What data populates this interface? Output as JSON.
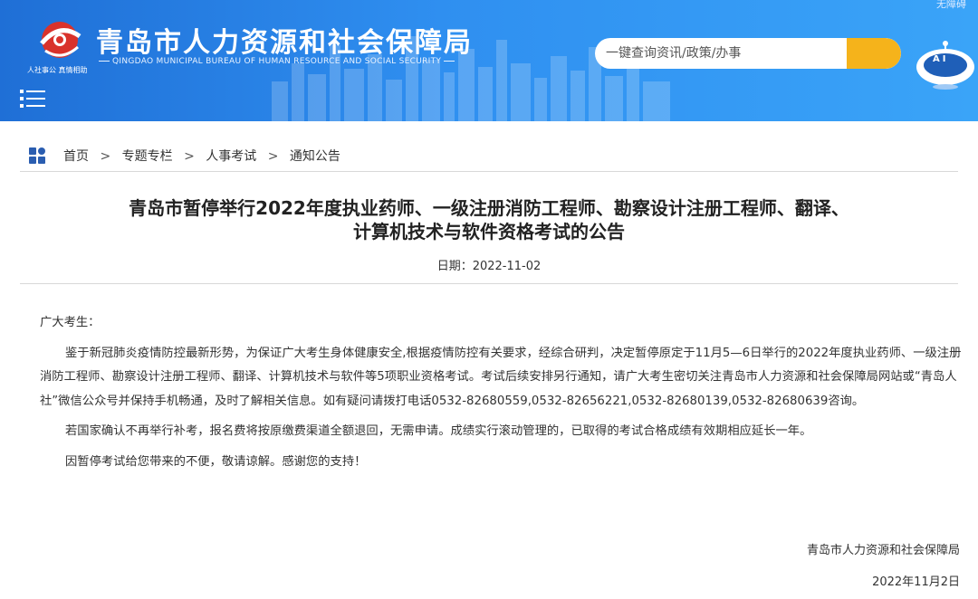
{
  "header": {
    "site_title": "青岛市人力资源和社会保障局",
    "site_subtitle": "QINGDAO MUNICIPAL BUREAU OF HUMAN RESOURCE AND SOCIAL SECURITY",
    "logo_tagline": "人社事公  真情相助",
    "accessibility_link": "无障碍",
    "search_placeholder": "一键查询资讯/政策/办事",
    "ai_label": "AI",
    "colors": {
      "header_blue": "#2f8ff0",
      "search_button": "#f5b31b"
    },
    "icons": [
      "logo-emblem-icon",
      "menu-icon",
      "ai-robot-icon"
    ]
  },
  "breadcrumb": {
    "icon": "grid-icon",
    "items": [
      "首页",
      "专题专栏",
      "人事考试",
      "通知公告"
    ],
    "separator": ">"
  },
  "article": {
    "title_line1": "青岛市暂停举行2022年度执业药师、一级注册消防工程师、勘察设计注册工程师、翻译、",
    "title_line2": "计算机技术与软件资格考试的公告",
    "date_label": "日期：",
    "date": "2022-11-02",
    "salutation": "广大考生：",
    "paragraphs": [
      "鉴于新冠肺炎疫情防控最新形势，为保证广大考生身体健康安全,根据疫情防控有关要求，经综合研判，决定暂停原定于11月5—6日举行的2022年度执业药师、一级注册消防工程师、勘察设计注册工程师、翻译、计算机技术与软件等5项职业资格考试。考试后续安排另行通知，请广大考生密切关注青岛市人力资源和社会保障局网站或“青岛人社”微信公众号并保持手机畅通，及时了解相关信息。如有疑问请拨打电话0532-82680559,0532-82656221,0532-82680139,0532-82680639咨询。",
      "若国家确认不再举行补考，报名费将按原缴费渠道全额退回，无需申请。成绩实行滚动管理的，已取得的考试合格成绩有效期相应延长一年。",
      "因暂停考试给您带来的不便，敬请谅解。感谢您的支持！"
    ],
    "signature_org": "青岛市人力资源和社会保障局",
    "signature_date": "2022年11月2日"
  }
}
